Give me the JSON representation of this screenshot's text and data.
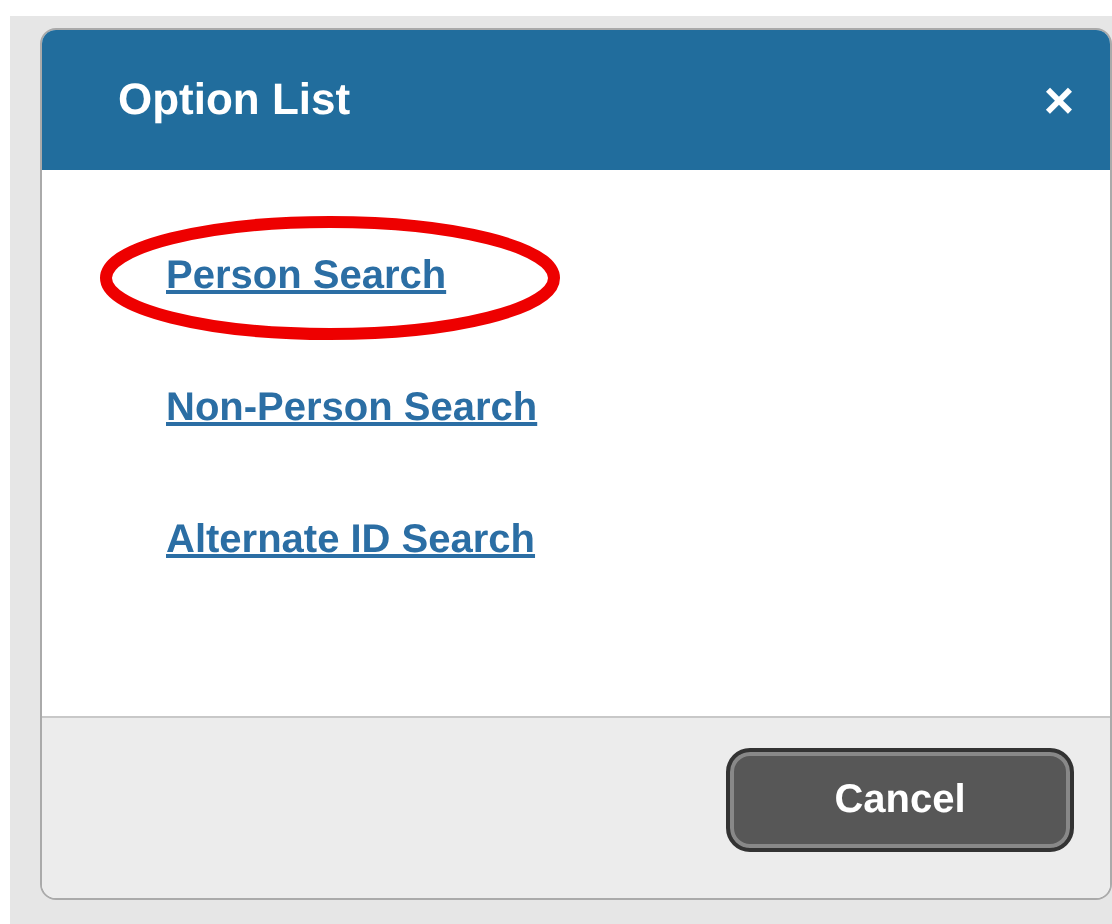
{
  "dialog": {
    "title": "Option List",
    "close": "×"
  },
  "options": [
    {
      "label": "Person Search",
      "circled": true
    },
    {
      "label": "Non-Person Search",
      "circled": false
    },
    {
      "label": "Alternate ID Search",
      "circled": false
    }
  ],
  "buttons": [
    "Cancel"
  ]
}
